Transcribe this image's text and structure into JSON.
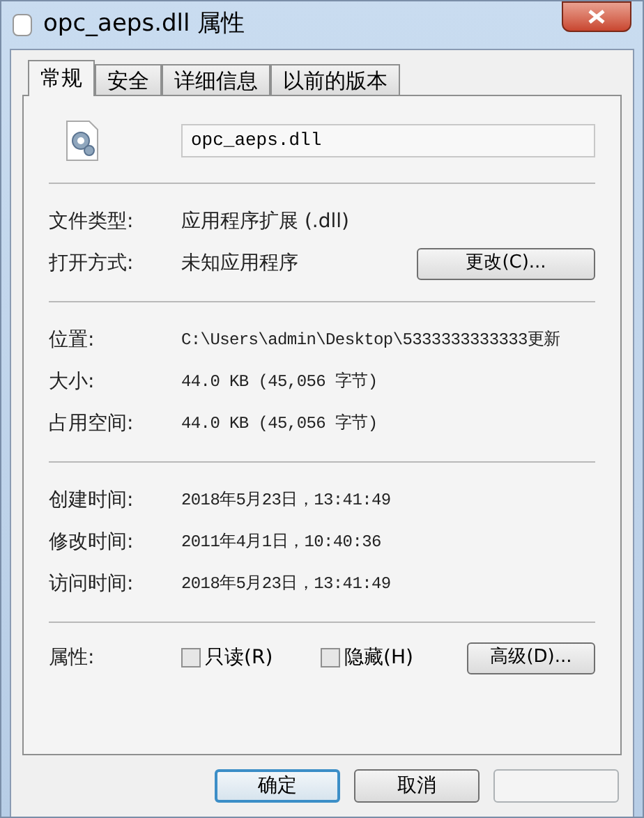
{
  "window": {
    "title": "opc_aeps.dll 属性"
  },
  "tabs": [
    {
      "label": "常规",
      "selected": true
    },
    {
      "label": "安全",
      "selected": false
    },
    {
      "label": "详细信息",
      "selected": false
    },
    {
      "label": "以前的版本",
      "selected": false
    }
  ],
  "file_name": "opc_aeps.dll",
  "sections": [
    [
      {
        "label": "文件类型:",
        "value": "应用程序扩展 (.dll)"
      },
      {
        "label": "打开方式:",
        "value": "未知应用程序",
        "button": "更改(C)..."
      }
    ],
    [
      {
        "label": "位置:",
        "value": "C:\\Users\\admin\\Desktop\\5333333333333更新"
      },
      {
        "label": "大小:",
        "value": "44.0 KB (45,056 字节)"
      },
      {
        "label": "占用空间:",
        "value": "44.0 KB (45,056 字节)"
      }
    ],
    [
      {
        "label": "创建时间:",
        "value": "2018年5月23日，13:41:49"
      },
      {
        "label": "修改时间:",
        "value": "2011年4月1日，10:40:36"
      },
      {
        "label": "访问时间:",
        "value": "2018年5月23日，13:41:49"
      }
    ]
  ],
  "attributes": {
    "label": "属性:",
    "checkboxes": [
      {
        "label": "只读(R)",
        "checked": false
      },
      {
        "label": "隐藏(H)",
        "checked": false
      }
    ],
    "button": "高级(D)..."
  },
  "buttons": [
    {
      "label": "确定",
      "default": true
    },
    {
      "label": "取消",
      "default": false
    }
  ],
  "apply_button": {
    "disabled": true
  }
}
